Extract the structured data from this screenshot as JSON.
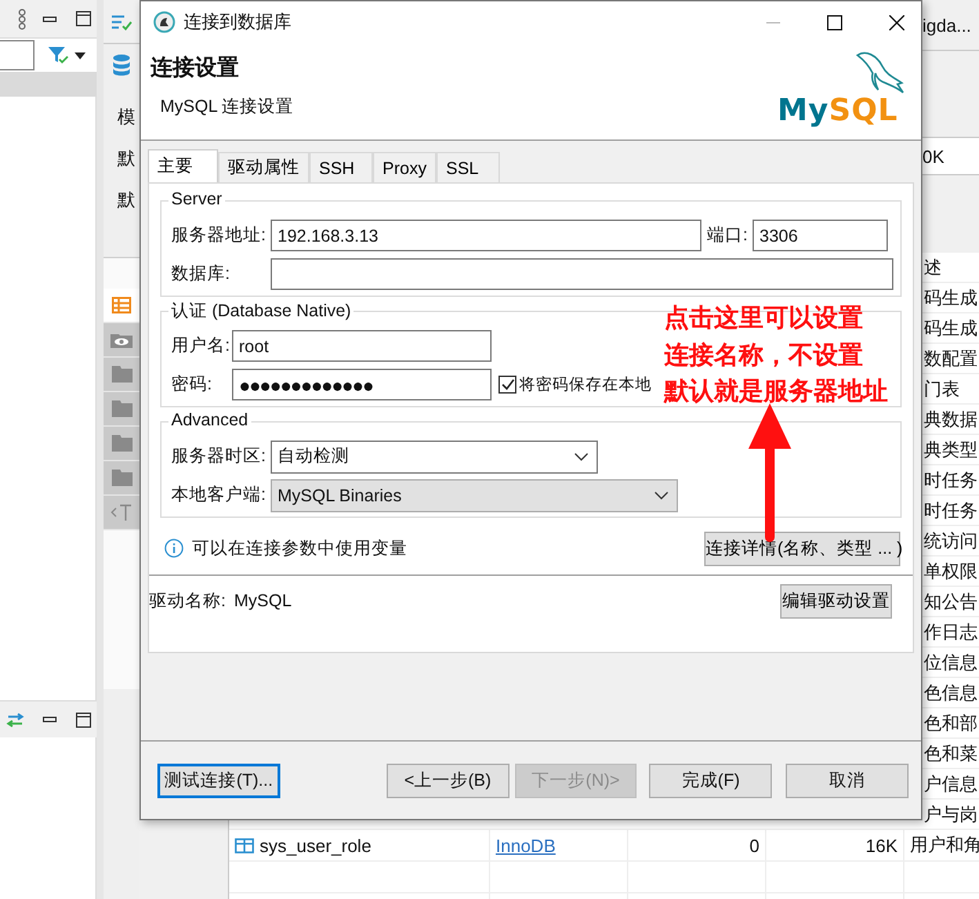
{
  "side_strip": {
    "labels": [
      "模",
      "默",
      "默"
    ],
    "tabs": [
      {
        "kind": "table",
        "selected": true
      },
      {
        "kind": "view",
        "selected": false
      },
      {
        "kind": "folder",
        "selected": false
      },
      {
        "kind": "folder",
        "selected": false
      },
      {
        "kind": "folder",
        "selected": false
      },
      {
        "kind": "folder",
        "selected": false
      },
      {
        "kind": "text",
        "selected": false
      }
    ]
  },
  "background": {
    "title_fragment": "igda...",
    "value_fragment": "0K",
    "comment_fragments": [
      "述",
      "码生成",
      "码生成",
      "数配置",
      "门表",
      "典数据",
      "典类型",
      "时任务",
      "时任务",
      "统访问",
      "单权限",
      "知公告",
      "作日志",
      "位信息",
      "色信息",
      "色和部",
      "色和菜",
      "户信息",
      "户与岗"
    ],
    "table_row": {
      "name": "sys_user_role",
      "engine": "InnoDB",
      "row_count": "0",
      "size": "16K",
      "comment": "用户和角"
    }
  },
  "dialog": {
    "title": "连接到数据库",
    "heading": "连接设置",
    "subheading": "MySQL 连接设置",
    "logo": [
      {
        "text": "My",
        "color": "#00758f"
      },
      {
        "text": "SQL",
        "color": "#f29111"
      }
    ],
    "tabs": [
      {
        "label": "主要",
        "selected": true
      },
      {
        "label": "驱动属性",
        "selected": false
      },
      {
        "label": "SSH",
        "selected": false
      },
      {
        "label": "Proxy",
        "selected": false
      },
      {
        "label": "SSL",
        "selected": false
      }
    ],
    "server": {
      "legend": "Server",
      "host_label": "服务器地址:",
      "host": "192.168.3.13",
      "port_label": "端口:",
      "port": "3306",
      "database_label": "数据库:"
    },
    "auth": {
      "legend": "认证 (Database Native)",
      "user_label": "用户名:",
      "user": "root",
      "password_label": "密码:",
      "password": "●●●●●●●●●●●●●",
      "save_password": {
        "label": "将密码保存在本地",
        "checked": true
      }
    },
    "advanced": {
      "legend": "Advanced",
      "timezone_label": "服务器时区:",
      "timezone": "自动检测",
      "client_label": "本地客户端:",
      "client": "MySQL Binaries"
    },
    "info": "可以在连接参数中使用变量",
    "details_button": "连接详情(名称、类型 ... )",
    "driver_label": "驱动名称:",
    "driver": "MySQL",
    "edit_driver_button": "编辑驱动设置",
    "buttons": [
      {
        "label": "测试连接(T)...",
        "focused": true,
        "disabled": false
      },
      {
        "label": "<上一步(B)",
        "focused": false,
        "disabled": false
      },
      {
        "label": "下一步(N)>",
        "focused": false,
        "disabled": true
      },
      {
        "label": "完成(F)",
        "focused": false,
        "disabled": false
      },
      {
        "label": "取消",
        "focused": false,
        "disabled": false
      }
    ]
  },
  "annotation": {
    "lines": [
      "点击这里可以设置",
      "连接名称，不设置",
      "默认就是服务器地址"
    ]
  }
}
